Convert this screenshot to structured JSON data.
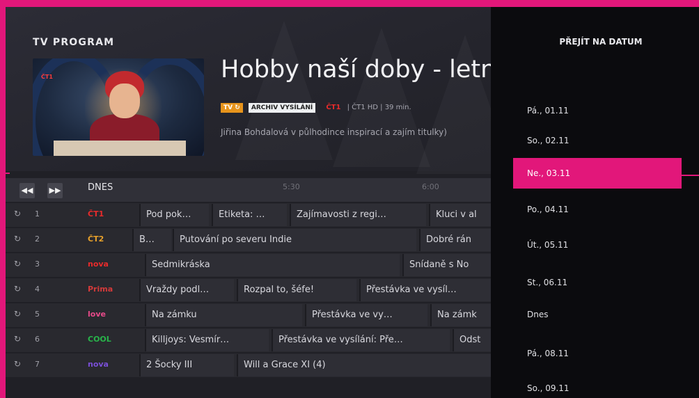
{
  "app": {
    "title": "TV PROGRAM"
  },
  "program": {
    "title": "Hobby naší doby - letní s",
    "badge_tv": "TV ↻",
    "badge_archive": "ARCHIV VYSÍLÁNÍ",
    "channel_logo": "ČT1",
    "meta": "| ČT1 HD | 39 min.",
    "description": "Jiřina Bohdalová v půlhodince inspirací a zajím titulky)"
  },
  "timebar": {
    "back_icon": "rewind-icon",
    "forward_icon": "fast-forward-icon",
    "day": "DNES",
    "times": [
      "5:30",
      "6:00"
    ]
  },
  "channels": [
    {
      "number": "1",
      "logo": "ČT1",
      "logo_color": "#e82b2b",
      "programs": [
        "Pod pok…",
        "Etiketa: …",
        "Zajímavosti z regi…",
        "Kluci v al"
      ]
    },
    {
      "number": "2",
      "logo": "ČT2",
      "logo_color": "#e8a12b",
      "programs": [
        "B…",
        "Putování po severu Indie",
        "Dobré rán"
      ]
    },
    {
      "number": "3",
      "logo": "nova",
      "logo_color": "#e82b2b",
      "programs": [
        "Sedmikráska",
        "Snídaně s No"
      ]
    },
    {
      "number": "4",
      "logo": "Prima",
      "logo_color": "#d43a3a",
      "programs": [
        "Vraždy podl…",
        "Rozpal to, šéfe!",
        "Přestávka ve vysíl…"
      ]
    },
    {
      "number": "5",
      "logo": "love",
      "logo_color": "#e84a8a",
      "programs": [
        "Na zámku",
        "Přestávka ve vy…",
        "Na zámk"
      ]
    },
    {
      "number": "6",
      "logo": "COOL",
      "logo_color": "#28b44a",
      "programs": [
        "Killjoys: Vesmír…",
        "Přestávka ve vysílání: Pře…",
        "Odst"
      ]
    },
    {
      "number": "7",
      "logo": "nova",
      "logo_color": "#7a4fd8",
      "programs": [
        "2 Šocky III",
        "Will a Grace XI (4)"
      ]
    }
  ],
  "date_panel": {
    "title": "PŘEJÍT NA DATUM",
    "items": [
      "Pá., 01.11",
      "So., 02.11",
      "Ne., 03.11",
      "Po., 04.11",
      "Út., 05.11",
      "St., 06.11",
      "Dnes",
      "Pá., 08.11",
      "So., 09.11"
    ],
    "selected": "Ne., 03.11",
    "accent_color": "#e2177a"
  }
}
